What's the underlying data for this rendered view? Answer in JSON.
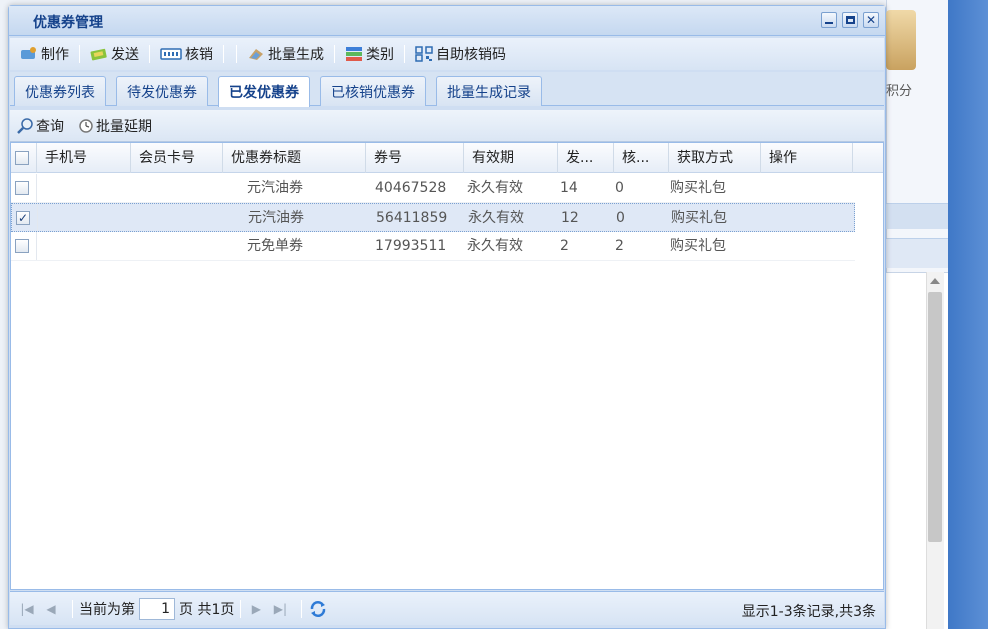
{
  "background": {
    "side_text": "积分"
  },
  "window": {
    "title": "优惠券管理"
  },
  "toolbar": {
    "items": [
      {
        "label": "制作",
        "icon": "make-coupon-icon"
      },
      {
        "label": "发送",
        "icon": "send-icon"
      },
      {
        "label": "核销",
        "icon": "verify-icon"
      },
      {
        "label": "批量生成",
        "icon": "batch-generate-icon"
      },
      {
        "label": "类别",
        "icon": "category-icon"
      },
      {
        "label": "自助核销码",
        "icon": "qr-code-icon"
      }
    ]
  },
  "tabs": [
    {
      "label": "优惠券列表",
      "active": false
    },
    {
      "label": "待发优惠券",
      "active": false
    },
    {
      "label": "已发优惠券",
      "active": true
    },
    {
      "label": "已核销优惠券",
      "active": false
    },
    {
      "label": "批量生成记录",
      "active": false
    }
  ],
  "subtoolbar": {
    "query_label": "查询",
    "extend_label": "批量延期"
  },
  "grid": {
    "columns": [
      "手机号",
      "会员卡号",
      "优惠券标题",
      "券号",
      "有效期",
      "发...",
      "核...",
      "获取方式",
      "操作"
    ],
    "rows": [
      {
        "checked": false,
        "phone": "",
        "card": "",
        "title": "元汽油券",
        "number": "40467528",
        "validity": "永久有效",
        "issued": "14",
        "verified": "0",
        "method": "购买礼包",
        "op": ""
      },
      {
        "checked": true,
        "phone": "",
        "card": "",
        "title": "元汽油券",
        "number": "56411859",
        "validity": "永久有效",
        "issued": "12",
        "verified": "0",
        "method": "购买礼包",
        "op": ""
      },
      {
        "checked": false,
        "phone": "",
        "card": "",
        "title": "元免单券",
        "number": "17993511",
        "validity": "永久有效",
        "issued": "2",
        "verified": "2",
        "method": "购买礼包",
        "op": ""
      }
    ]
  },
  "paging": {
    "prefix": "当前为第",
    "page": "1",
    "suffix": "页 共1页",
    "info": "显示1-3条记录,共3条"
  },
  "colors": {
    "title_text": "#15428b",
    "border": "#99bbe8",
    "selected_row": "#dfe8f6"
  }
}
